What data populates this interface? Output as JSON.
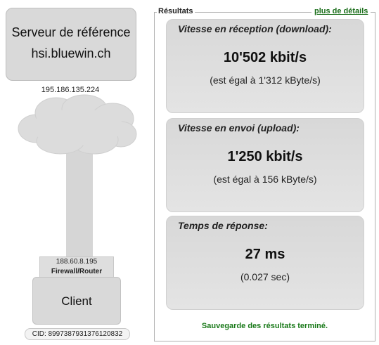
{
  "diagram": {
    "server": {
      "title": "Serveur de référence",
      "host": "hsi.bluewin.ch",
      "ip": "195.186.135.224"
    },
    "router": {
      "ip": "188.60.8.195",
      "label": "Firewall/Router"
    },
    "client": {
      "label": "Client",
      "cid": "CID: 8997387931376120832"
    }
  },
  "results": {
    "legend": "Résultats",
    "details_link": "plus de détails",
    "cards": [
      {
        "title": "Vitesse en réception (download):",
        "value": "10'502 kbit/s",
        "sub": "(est égal à 1'312 kByte/s)"
      },
      {
        "title": "Vitesse en envoi (upload):",
        "value": "1'250 kbit/s",
        "sub": "(est égal à 156 kByte/s)"
      },
      {
        "title": "Temps de réponse:",
        "value": "27 ms",
        "sub": "(0.027 sec)"
      }
    ],
    "status": "Sauvegarde des résultats terminé.",
    "status_color": "#1a7a1a",
    "link_color": "#1a6e1a"
  }
}
